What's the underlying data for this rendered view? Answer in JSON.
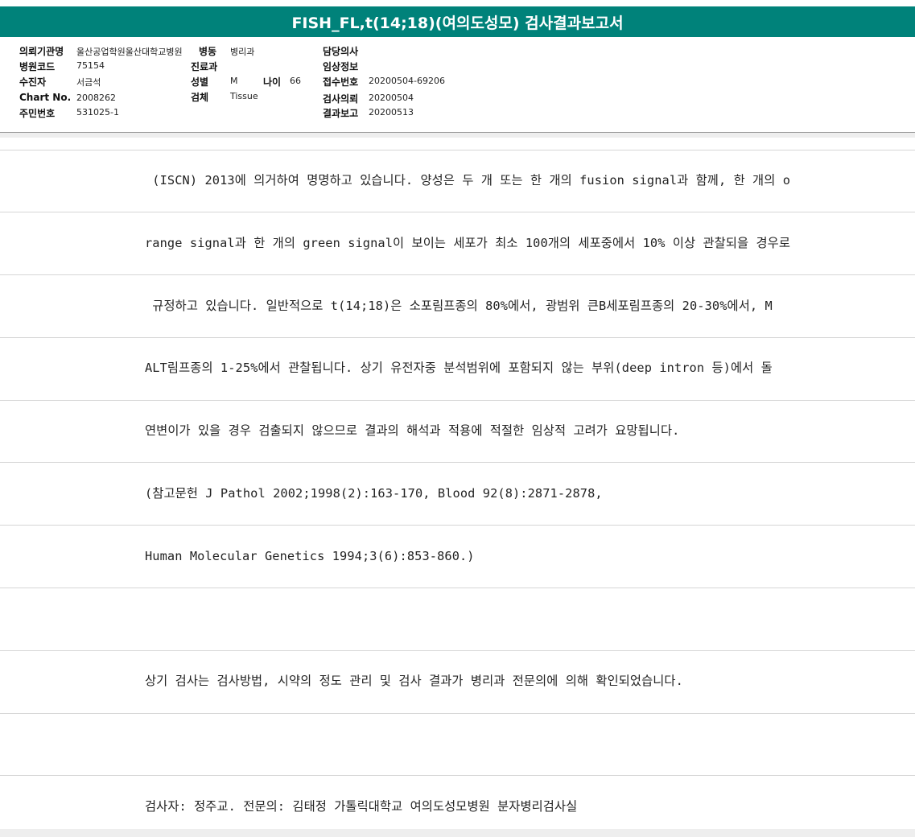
{
  "title": "FISH_FL,t(14;18)(여의도성모) 검사결과보고서",
  "header": {
    "left": [
      {
        "label": "의뢰기관명",
        "value": "울산공업학원울산대학교병원"
      },
      {
        "label": "병원코드",
        "value": "75154"
      },
      {
        "label": "수진자",
        "value": "서금석"
      },
      {
        "label": "Chart No.",
        "value": "2008262"
      },
      {
        "label": "주민번호",
        "value": "531025-1"
      }
    ],
    "ward_label": "병동",
    "ward_value": "병리과",
    "dept_label": "진료과",
    "sex_label": "성별",
    "sex_value": "M",
    "age_label": "나이",
    "age_value": "66",
    "specimen_label": "검체",
    "specimen_value": "Tissue",
    "right": [
      {
        "label": "담당의사",
        "value": ""
      },
      {
        "label": "임상정보",
        "value": ""
      },
      {
        "label": "접수번호",
        "value": "20200504-69206"
      },
      {
        "label": "검사의뢰",
        "value": "20200504"
      },
      {
        "label": "결과보고",
        "value": "20200513"
      }
    ]
  },
  "content_lines": [
    " (ISCN) 2013에 의거하여 명명하고 있습니다. 양성은 두 개 또는 한 개의 fusion signal과 함께, 한 개의 o",
    "range signal과 한 개의 green signal이 보이는 세포가 최소 100개의 세포중에서 10% 이상 관찰되을 경우로",
    " 규정하고 있습니다. 일반적으로 t(14;18)은 소포림프종의 80%에서, 광범위 큰B세포림프종의 20-30%에서, M",
    "ALT림프종의 1-25%에서 관찰됩니다. 상기 유전자중 분석범위에 포함되지 않는 부위(deep intron 등)에서 돌",
    "연변이가 있을 경우 검출되지 않으므로 결과의 해석과 적용에 적절한 임상적 고려가 요망됩니다.",
    "(참고문헌 J Pathol 2002;1998(2):163-170, Blood 92(8):2871-2878,",
    "Human Molecular Genetics 1994;3(6):853-860.)",
    "",
    "상기 검사는 검사방법, 시약의 정도 관리 및 검사 결과가 병리과 전문의에 의해 확인되었습니다.",
    "",
    "검사자: 정주교. 전문의: 김태정 가톨릭대학교 여의도성모병원 분자병리검사실"
  ]
}
